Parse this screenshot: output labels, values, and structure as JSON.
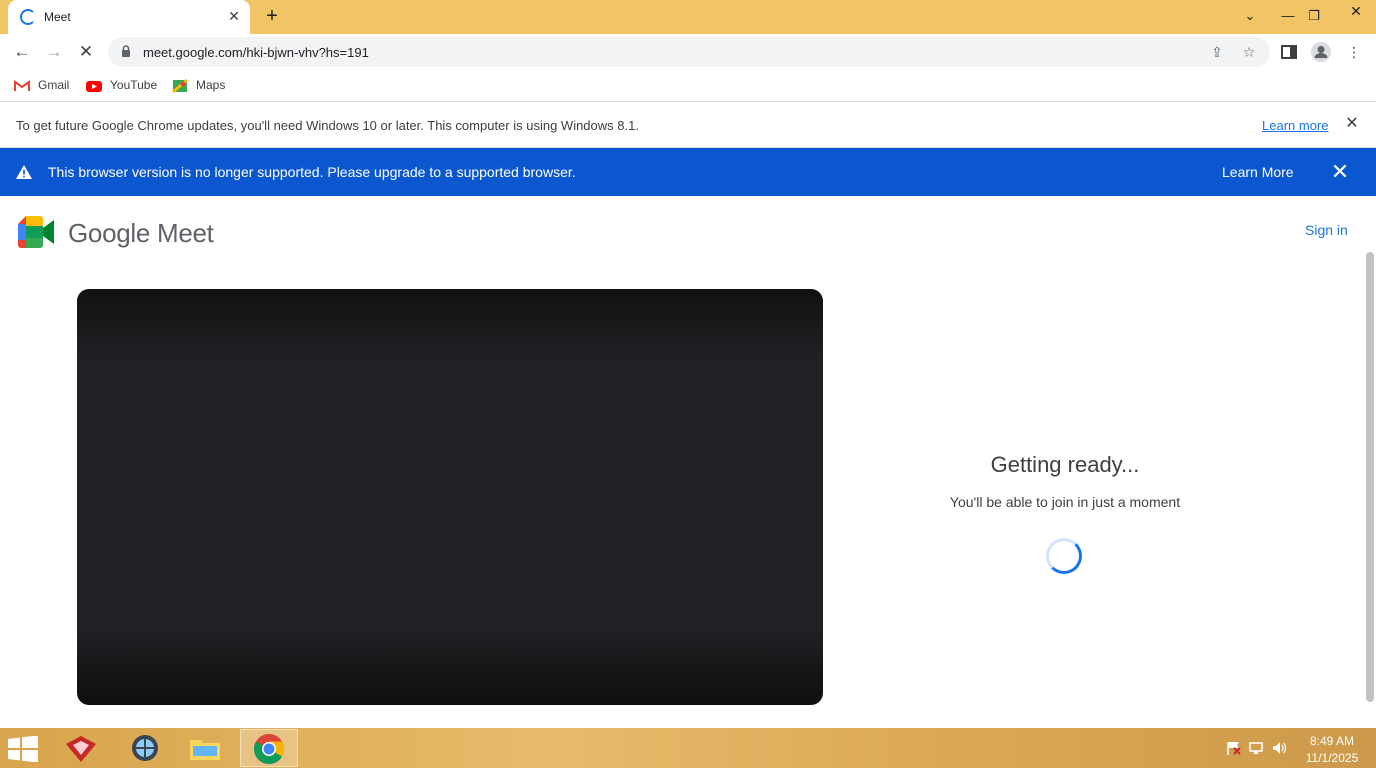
{
  "tab": {
    "title": "Meet",
    "close_glyph": "✕",
    "new_tab_glyph": "+",
    "icon": "loading-spinner-icon"
  },
  "window_controls": {
    "tab_search_glyph": "⌄",
    "minimize_glyph": "—",
    "restore_glyph": "❐",
    "close_glyph": "✕"
  },
  "toolbar": {
    "back_glyph": "←",
    "forward_glyph": "→",
    "stop_glyph": "✕",
    "url": "meet.google.com/hki-bjwn-vhv?hs=191",
    "share_glyph": "⇪",
    "star_glyph": "☆",
    "menu_glyph": "⋮"
  },
  "bookmarks": [
    {
      "label": "Gmail",
      "icon": "gmail-icon"
    },
    {
      "label": "YouTube",
      "icon": "youtube-icon"
    },
    {
      "label": "Maps",
      "icon": "maps-icon"
    }
  ],
  "infobar": {
    "text": "To get future Google Chrome updates, you'll need Windows 10 or later. This computer is using Windows 8.1.",
    "link": "Learn more",
    "close_glyph": "✕"
  },
  "banner": {
    "text": "This browser version is no longer supported. Please upgrade to a supported browser.",
    "link": "Learn More",
    "close_glyph": "✕",
    "color": "#0b57d0"
  },
  "page": {
    "logo_text": "Google Meet",
    "signin": "Sign in",
    "ready_title": "Getting ready...",
    "ready_subtitle": "You'll be able to join in just a moment"
  },
  "taskbar": {
    "time": "8:49 AM",
    "date": "11/1/2025"
  },
  "colors": {
    "accent": "#1a73e8",
    "tabstrip": "#f1c565"
  }
}
